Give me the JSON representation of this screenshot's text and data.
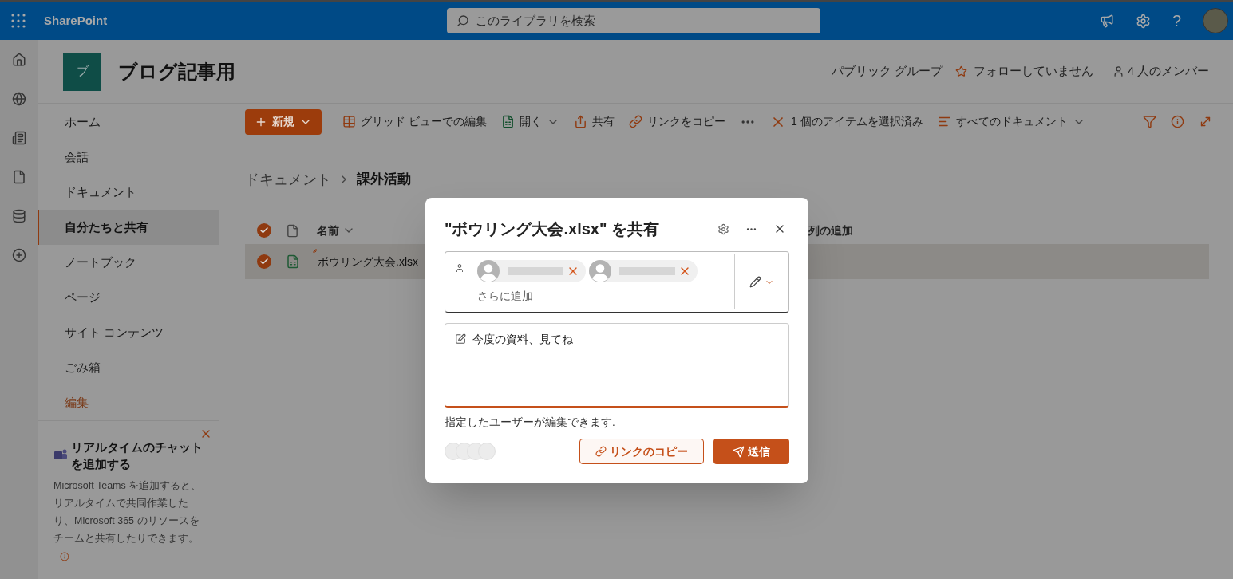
{
  "header": {
    "app_name": "SharePoint",
    "search_placeholder": "このライブラリを検索",
    "help_label": "?"
  },
  "site": {
    "logo_letter": "ブ",
    "title": "ブログ記事用",
    "group_type": "パブリック グループ",
    "follow": "フォローしていません",
    "members": "4 人のメンバー"
  },
  "nav": {
    "items": [
      {
        "label": "ホーム",
        "selected": false,
        "kind": "page"
      },
      {
        "label": "会話",
        "selected": false,
        "kind": "page"
      },
      {
        "label": "ドキュメント",
        "selected": false,
        "kind": "page"
      },
      {
        "label": "自分たちと共有",
        "selected": true,
        "kind": "page"
      },
      {
        "label": "ノートブック",
        "selected": false,
        "kind": "page"
      },
      {
        "label": "ページ",
        "selected": false,
        "kind": "page"
      },
      {
        "label": "サイト コンテンツ",
        "selected": false,
        "kind": "page"
      },
      {
        "label": "ごみ箱",
        "selected": false,
        "kind": "page"
      },
      {
        "label": "編集",
        "selected": false,
        "kind": "edit"
      }
    ]
  },
  "teams_card": {
    "title": "リアルタイムのチャットを追加する",
    "body": "Microsoft Teams を追加すると、リアルタイムで共同作業したり、Microsoft 365 のリソースをチームと共有したりできます。"
  },
  "toolbar": {
    "items": [
      {
        "kind": "new",
        "label": "新規"
      },
      {
        "kind": "grid_edit",
        "label": "グリッド ビューでの編集"
      },
      {
        "kind": "open",
        "label": "開く"
      },
      {
        "kind": "share",
        "label": "共有"
      },
      {
        "kind": "copy_link",
        "label": "リンクをコピー"
      },
      {
        "kind": "more"
      },
      {
        "kind": "selection",
        "label": "1 個のアイテムを選択済み"
      },
      {
        "kind": "view",
        "label": "すべてのドキュメント"
      },
      {
        "kind": "filter"
      },
      {
        "kind": "info"
      },
      {
        "kind": "expand"
      }
    ]
  },
  "breadcrumb": {
    "parent": "ドキュメント",
    "current": "課外活動"
  },
  "list": {
    "all_checked": true,
    "columns": [
      {
        "label": "名前",
        "kind": "name"
      },
      {
        "label": "列の追加",
        "kind": "add"
      }
    ],
    "rows": [
      {
        "name": "ボウリング大会.xlsx",
        "checked": true,
        "selected": true,
        "is_new": true
      }
    ]
  },
  "dialog": {
    "title": "\"ボウリング大会.xlsx\" を共有",
    "recipients": [
      {
        "kind": "person"
      },
      {
        "kind": "person"
      }
    ],
    "add_placeholder": "さらに追加",
    "message": "今度の資料、見てね",
    "message_focused": true,
    "permission_note": "指定したユーザーが編集できます.",
    "copy_link": "リンクのコピー",
    "send": "送信"
  }
}
